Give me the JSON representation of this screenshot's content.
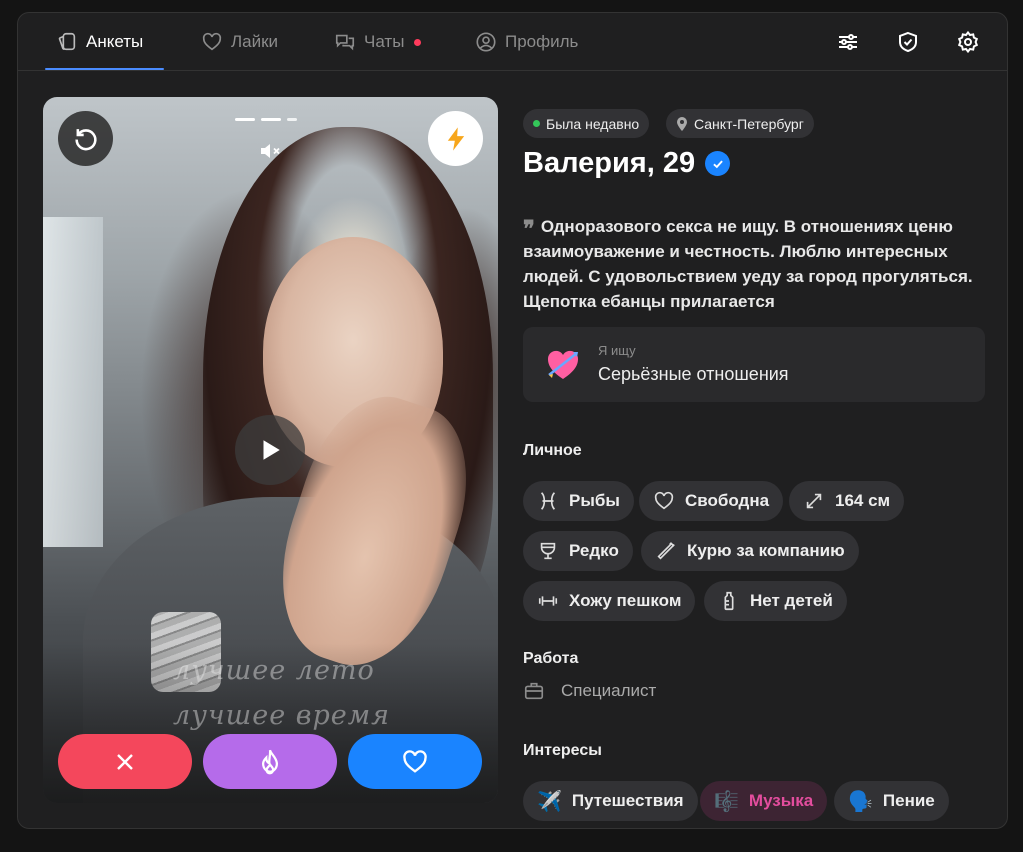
{
  "nav": {
    "tabs": [
      {
        "label": "Анкеты",
        "icon": "cards-icon",
        "active": true
      },
      {
        "label": "Лайки",
        "icon": "heart-icon",
        "active": false
      },
      {
        "label": "Чаты",
        "icon": "chat-icon",
        "active": false,
        "has_unread": true
      },
      {
        "label": "Профиль",
        "icon": "profile-icon",
        "active": false
      }
    ],
    "tools": [
      "filters-icon",
      "shield-icon",
      "gear-icon"
    ]
  },
  "photo": {
    "stories_progress": [
      1,
      1,
      0.5
    ],
    "captions": [
      "лучшее лето",
      "лучшее время"
    ],
    "actions": [
      "dislike",
      "super-like",
      "like"
    ]
  },
  "profile": {
    "status": "Была недавно",
    "city": "Санкт-Петербург",
    "name": "Валерия, 29",
    "bio": "Одноразового секса не ищу. В отношениях ценю взаимоуважение и честность. Люблю интересных людей. С удовольствием уеду за город прогуляться. Щепотка ебанцы прилагается",
    "goal": {
      "label": "Я ищу",
      "value": "Серьёзные отношения",
      "emoji": "💘"
    },
    "personal_title": "Личное",
    "personal": [
      {
        "label": "Рыбы",
        "icon": "pisces-icon"
      },
      {
        "label": "Свободна",
        "icon": "heart-outline-icon"
      },
      {
        "label": "164 см",
        "icon": "height-icon"
      },
      {
        "label": "Редко",
        "icon": "glass-icon"
      },
      {
        "label": "Курю за компанию",
        "icon": "cigarette-icon"
      },
      {
        "label": "Хожу пешком",
        "icon": "dumbbell-icon"
      },
      {
        "label": "Нет детей",
        "icon": "baby-bottle-icon"
      }
    ],
    "work_title": "Работа",
    "work": "Специалист",
    "interests_title": "Интересы",
    "interests": [
      {
        "label": "Путешествия",
        "emoji": "✈️"
      },
      {
        "label": "Музыка",
        "emoji": "🎼"
      },
      {
        "label": "Пение",
        "emoji": "🗣️"
      }
    ]
  },
  "colors": {
    "accent": "#1a84ff",
    "dislike": "#f4475c",
    "superlike": "#b56bea",
    "online": "#34c759",
    "unread": "#ff3b5c"
  }
}
